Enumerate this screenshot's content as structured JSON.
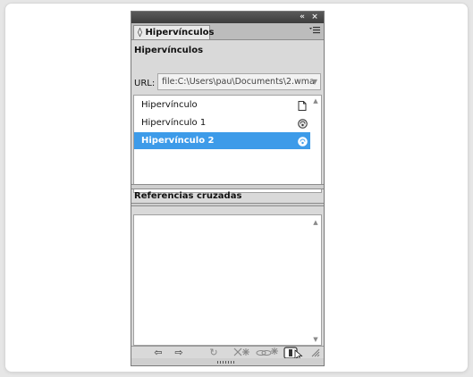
{
  "panel": {
    "titlebar": {
      "collapse_glyph": "«",
      "close_glyph": "×"
    },
    "tab": {
      "arrow_glyph": "◊",
      "label": "Hipervínculos"
    },
    "menu_icon": "panel-menu-icon",
    "section_title": "Hipervínculos",
    "url_label": "URL:",
    "url_value": "file:C:\\Users\\pau\\Documents\\2.wma",
    "hyperlinks": [
      {
        "label": "Hipervínculo",
        "icon": "document-icon",
        "selected": false
      },
      {
        "label": "Hipervínculo 1",
        "icon": "url-globe-icon",
        "selected": false
      },
      {
        "label": "Hipervínculo 2",
        "icon": "url-globe-icon",
        "selected": true
      }
    ],
    "cross_refs_title": "Referencias cruzadas",
    "bottom_toolbar": {
      "prev_glyph": "⇦",
      "next_glyph": "⇨",
      "refresh_glyph": "↻",
      "new_glyph": "✳",
      "edit_glyph": "✱",
      "selected_color": "#3d9be9"
    }
  }
}
